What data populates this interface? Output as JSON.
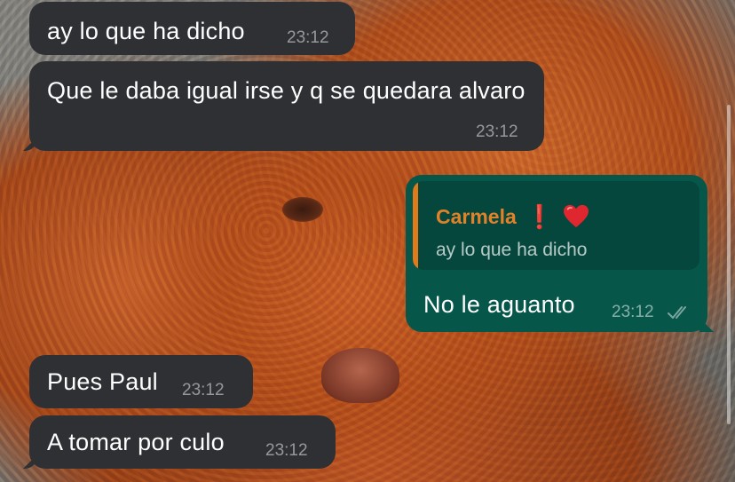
{
  "messages": [
    {
      "id": "b1",
      "direction": "incoming",
      "text": "ay lo que ha dicho",
      "time": "23:12"
    },
    {
      "id": "b2",
      "direction": "incoming",
      "text": "Que le daba igual irse y q se quedara alvaro",
      "time": "23:12"
    },
    {
      "id": "b3",
      "direction": "outgoing",
      "reply_to": {
        "author": "Carmela",
        "author_emoji": "❗",
        "quoted_text": "ay lo que ha dicho"
      },
      "text": "No le aguanto",
      "time": "23:12",
      "status_icon": "double-check-icon"
    },
    {
      "id": "b4",
      "direction": "incoming",
      "text": "Pues Paul",
      "time": "23:12"
    },
    {
      "id": "b5",
      "direction": "incoming",
      "text": "A tomar por culo",
      "time": "23:12"
    }
  ],
  "colors": {
    "incoming_bubble": "#2f3034",
    "outgoing_bubble": "#07564a",
    "quote_background": "#05473d",
    "quote_accent": "#e07a1a",
    "author_name": "#e0822a",
    "heart": "#e0262e"
  },
  "wallpaper": "poodle-photo"
}
